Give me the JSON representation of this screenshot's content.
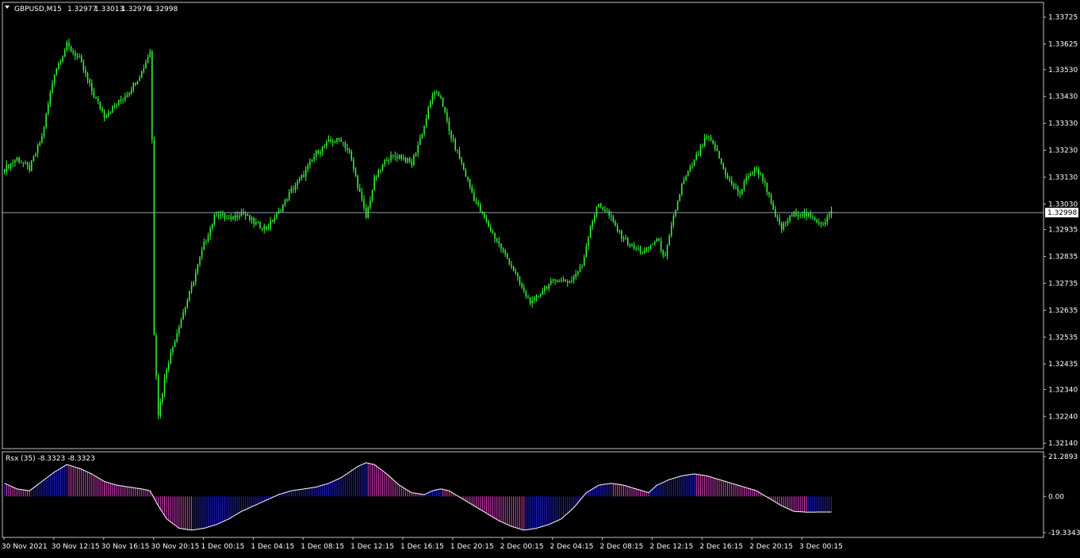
{
  "colors": {
    "background": "#000000",
    "frame": "#c0c0c0",
    "text": "#ffffff",
    "candle": "#33ff33",
    "current_price_line": "#8ea4b8",
    "current_price_box_bg": "#ffffff",
    "current_price_box_text": "#000000",
    "rsx_up": "#1f1fd8",
    "rsx_down": "#e040c8",
    "rsx_line": "#ffffff"
  },
  "chart_data": [
    {
      "type": "candlestick",
      "header": {
        "symbol": "GBPUSD,M15",
        "open": "1.32977",
        "high": "1.33013",
        "low": "1.32976",
        "close": "1.32998"
      },
      "y_ticks": [
        "1.33725",
        "1.33625",
        "1.33530",
        "1.33430",
        "1.33330",
        "1.33230",
        "1.33130",
        "1.33030",
        "1.32935",
        "1.32835",
        "1.32735",
        "1.32635",
        "1.32535",
        "1.32435",
        "1.32340",
        "1.32240",
        "1.32140"
      ],
      "ylim": [
        1.3212,
        1.3378
      ],
      "current_price": 1.32998,
      "current_price_label": "1.32998",
      "x_labels": [
        "30 Nov 2021",
        "30 Nov 12:15",
        "30 Nov 16:15",
        "30 Nov 20:15",
        "1 Dec 00:15",
        "1 Dec 04:15",
        "1 Dec 08:15",
        "1 Dec 12:15",
        "1 Dec 16:15",
        "1 Dec 20:15",
        "2 Dec 00:15",
        "2 Dec 04:15",
        "2 Dec 08:15",
        "2 Dec 12:15",
        "2 Dec 16:15",
        "2 Dec 20:15",
        "3 Dec 00:15"
      ],
      "close_path": [
        [
          0,
          1.3316
        ],
        [
          6,
          1.332
        ],
        [
          12,
          1.3316
        ],
        [
          18,
          1.3328
        ],
        [
          24,
          1.3352
        ],
        [
          30,
          1.3362
        ],
        [
          36,
          1.3357
        ],
        [
          42,
          1.3345
        ],
        [
          48,
          1.3336
        ],
        [
          54,
          1.334
        ],
        [
          60,
          1.3345
        ],
        [
          66,
          1.3352
        ],
        [
          70,
          1.336
        ],
        [
          71,
          1.3327
        ],
        [
          72,
          1.3255
        ],
        [
          74,
          1.3225
        ],
        [
          78,
          1.3242
        ],
        [
          84,
          1.3258
        ],
        [
          90,
          1.3272
        ],
        [
          96,
          1.3288
        ],
        [
          102,
          1.33
        ],
        [
          108,
          1.3297
        ],
        [
          114,
          1.33
        ],
        [
          120,
          1.3296
        ],
        [
          126,
          1.3294
        ],
        [
          132,
          1.33
        ],
        [
          138,
          1.3308
        ],
        [
          144,
          1.3314
        ],
        [
          150,
          1.3322
        ],
        [
          156,
          1.3326
        ],
        [
          162,
          1.3327
        ],
        [
          166,
          1.3322
        ],
        [
          170,
          1.331
        ],
        [
          174,
          1.3298
        ],
        [
          178,
          1.3312
        ],
        [
          184,
          1.332
        ],
        [
          190,
          1.3321
        ],
        [
          196,
          1.3318
        ],
        [
          202,
          1.3332
        ],
        [
          206,
          1.3344
        ],
        [
          210,
          1.3343
        ],
        [
          214,
          1.333
        ],
        [
          220,
          1.3318
        ],
        [
          226,
          1.3305
        ],
        [
          232,
          1.3296
        ],
        [
          238,
          1.3288
        ],
        [
          244,
          1.328
        ],
        [
          250,
          1.327
        ],
        [
          254,
          1.3266
        ],
        [
          260,
          1.3272
        ],
        [
          266,
          1.3275
        ],
        [
          272,
          1.3274
        ],
        [
          278,
          1.328
        ],
        [
          282,
          1.3295
        ],
        [
          286,
          1.3303
        ],
        [
          290,
          1.33
        ],
        [
          296,
          1.3292
        ],
        [
          302,
          1.3287
        ],
        [
          308,
          1.3285
        ],
        [
          314,
          1.329
        ],
        [
          318,
          1.3283
        ],
        [
          322,
          1.3298
        ],
        [
          326,
          1.331
        ],
        [
          330,
          1.3316
        ],
        [
          334,
          1.3322
        ],
        [
          338,
          1.3328
        ],
        [
          342,
          1.3324
        ],
        [
          346,
          1.3316
        ],
        [
          350,
          1.331
        ],
        [
          354,
          1.3307
        ],
        [
          358,
          1.3314
        ],
        [
          362,
          1.3316
        ],
        [
          366,
          1.3311
        ],
        [
          370,
          1.33
        ],
        [
          374,
          1.3294
        ],
        [
          378,
          1.3298
        ],
        [
          382,
          1.33
        ],
        [
          386,
          1.3299
        ],
        [
          390,
          1.3297
        ],
        [
          394,
          1.3296
        ],
        [
          398,
          1.32998
        ]
      ],
      "candle_count": 399
    },
    {
      "type": "histogram",
      "title": "Rsx (35) -8.3323 -8.3323",
      "y_ticks": [
        "21.2893",
        "0.00",
        "-19.3343"
      ],
      "ylim": [
        -19.3343,
        21.2893
      ],
      "values_path": [
        [
          0,
          7
        ],
        [
          6,
          4
        ],
        [
          12,
          3
        ],
        [
          18,
          8
        ],
        [
          24,
          13
        ],
        [
          30,
          17
        ],
        [
          36,
          15
        ],
        [
          42,
          12
        ],
        [
          48,
          8
        ],
        [
          54,
          6
        ],
        [
          60,
          5
        ],
        [
          66,
          4
        ],
        [
          70,
          3
        ],
        [
          74,
          -5
        ],
        [
          78,
          -12
        ],
        [
          84,
          -17
        ],
        [
          90,
          -18
        ],
        [
          96,
          -17
        ],
        [
          102,
          -15
        ],
        [
          108,
          -12
        ],
        [
          114,
          -8
        ],
        [
          120,
          -5
        ],
        [
          126,
          -2
        ],
        [
          132,
          1
        ],
        [
          138,
          3
        ],
        [
          144,
          4
        ],
        [
          150,
          5
        ],
        [
          156,
          7
        ],
        [
          162,
          10
        ],
        [
          166,
          13
        ],
        [
          170,
          16
        ],
        [
          174,
          18
        ],
        [
          178,
          17
        ],
        [
          184,
          12
        ],
        [
          190,
          6
        ],
        [
          196,
          2
        ],
        [
          202,
          1
        ],
        [
          206,
          3
        ],
        [
          210,
          4
        ],
        [
          214,
          3
        ],
        [
          220,
          -1
        ],
        [
          226,
          -5
        ],
        [
          232,
          -9
        ],
        [
          238,
          -13
        ],
        [
          244,
          -16
        ],
        [
          250,
          -18
        ],
        [
          256,
          -17
        ],
        [
          262,
          -15
        ],
        [
          268,
          -12
        ],
        [
          274,
          -6
        ],
        [
          280,
          2
        ],
        [
          286,
          6
        ],
        [
          292,
          7
        ],
        [
          298,
          6
        ],
        [
          304,
          4
        ],
        [
          310,
          2
        ],
        [
          314,
          6
        ],
        [
          320,
          9
        ],
        [
          326,
          11
        ],
        [
          332,
          12
        ],
        [
          338,
          11
        ],
        [
          344,
          9
        ],
        [
          350,
          7
        ],
        [
          356,
          5
        ],
        [
          362,
          3
        ],
        [
          368,
          -1
        ],
        [
          374,
          -5
        ],
        [
          380,
          -8
        ],
        [
          386,
          -8.4
        ],
        [
          392,
          -8.3323
        ],
        [
          398,
          -8.3323
        ]
      ]
    }
  ]
}
